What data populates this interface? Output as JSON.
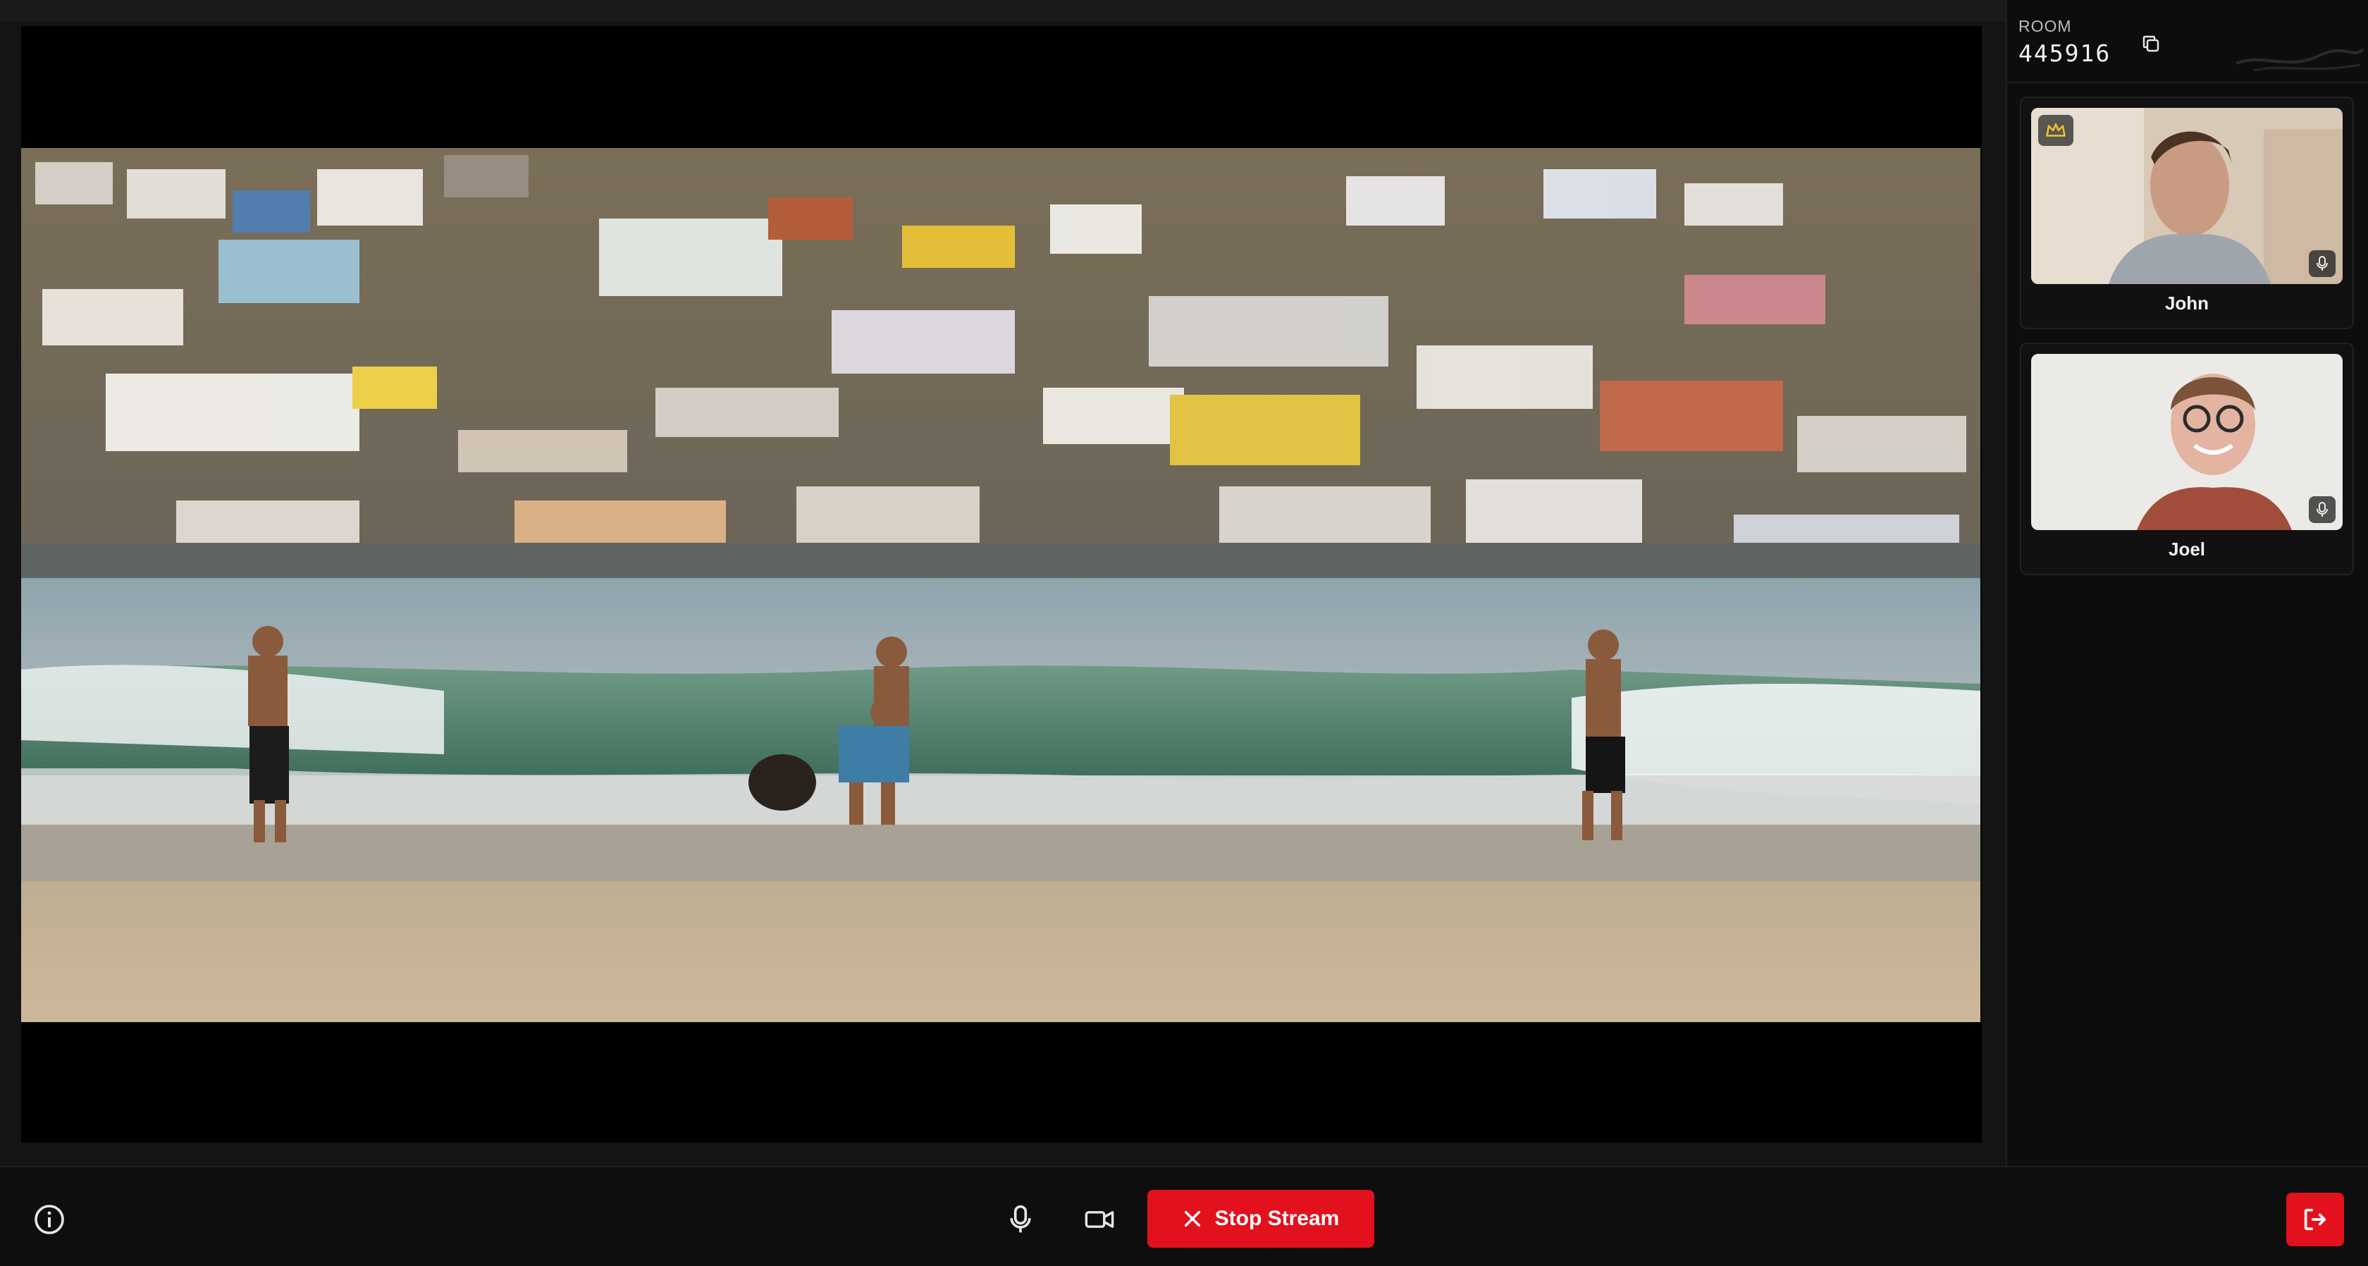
{
  "room": {
    "label": "ROOM",
    "code": "445916"
  },
  "participants": [
    {
      "name": "John",
      "is_host": true,
      "icon_host": "crown-icon",
      "icon_mic": "mic-icon"
    },
    {
      "name": "Joel",
      "is_host": false,
      "icon_mic": "mic-icon"
    }
  ],
  "controls": {
    "stop_stream_label": "Stop Stream",
    "icons": [
      "info-icon",
      "mic-icon",
      "camera-icon",
      "close-icon",
      "leave-icon",
      "copy-icon"
    ]
  },
  "colors": {
    "accent": "#e3101d",
    "background": "#141414",
    "host_badge": "#f2c230"
  }
}
